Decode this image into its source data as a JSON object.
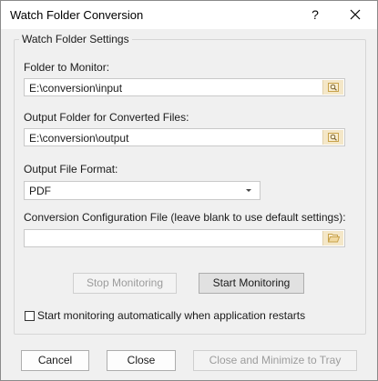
{
  "window": {
    "title": "Watch Folder Conversion",
    "help_glyph": "?"
  },
  "group": {
    "legend": "Watch Folder Settings"
  },
  "folder_to_monitor": {
    "label": "Folder to Monitor:",
    "value": "E:\\conversion\\input",
    "browse_icon": "search-folder-icon"
  },
  "output_folder": {
    "label": "Output Folder for Converted Files:",
    "value": "E:\\conversion\\output",
    "browse_icon": "search-folder-icon"
  },
  "output_format": {
    "label": "Output File Format:",
    "selected": "PDF"
  },
  "config_file": {
    "label": "Conversion Configuration File (leave blank to use default settings):",
    "value": "",
    "browse_icon": "open-folder-icon"
  },
  "monitoring": {
    "stop_label": "Stop Monitoring",
    "start_label": "Start Monitoring"
  },
  "auto_start": {
    "label": "Start monitoring automatically when application restarts",
    "checked": false
  },
  "footer": {
    "cancel_label": "Cancel",
    "close_label": "Close",
    "minimize_label": "Close and Minimize to Tray"
  },
  "colors": {
    "browse_button_bg": "#f4e7c8",
    "browse_icon": "#c8a24a",
    "dialog_bg": "#f0f0f0",
    "disabled_text": "#9c9c9c"
  }
}
